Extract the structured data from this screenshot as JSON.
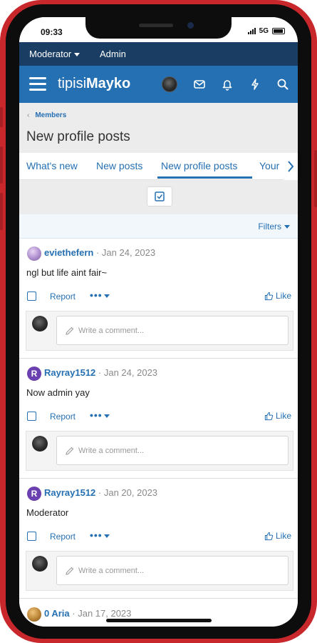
{
  "status": {
    "time": "09:33",
    "network": "5G"
  },
  "topbar": {
    "moderator": "Moderator",
    "admin": "Admin"
  },
  "navbar": {
    "logo_light": "tipisi",
    "logo_bold": "Mayko",
    "icons": [
      "menu-icon",
      "envelope-icon",
      "bell-icon",
      "bolt-icon",
      "search-icon"
    ]
  },
  "breadcrumb": {
    "label": "Members"
  },
  "page": {
    "title": "New profile posts"
  },
  "tabs": [
    {
      "label": "What's new"
    },
    {
      "label": "New posts"
    },
    {
      "label": "New profile posts"
    },
    {
      "label": "Your"
    }
  ],
  "filters": {
    "label": "Filters"
  },
  "posts": [
    {
      "user": "eviethefern",
      "date": " · Jan 24, 2023",
      "body": "ngl but life aint fair~",
      "avatar_letter": "",
      "avatar_color": "#b99ad6"
    },
    {
      "user": "Rayray1512",
      "date": " · Jan 24, 2023",
      "body": "Now admin yay",
      "avatar_letter": "R",
      "avatar_color": "#6a3fb0"
    },
    {
      "user": "Rayray1512",
      "date": " · Jan 20, 2023",
      "body": "Moderator",
      "avatar_letter": "R",
      "avatar_color": "#6a3fb0"
    },
    {
      "user": "0 Aria",
      "date": " · Jan 17, 2023",
      "body": "",
      "avatar_letter": "",
      "avatar_color": "#c08a3a"
    }
  ],
  "post_actions": {
    "report": "Report",
    "more": "•••",
    "like": "Like"
  },
  "comment": {
    "placeholder": "Write a comment..."
  },
  "colors": {
    "nav": "#2570b3",
    "topbar": "#1a3e63",
    "phone": "#c8272c"
  }
}
